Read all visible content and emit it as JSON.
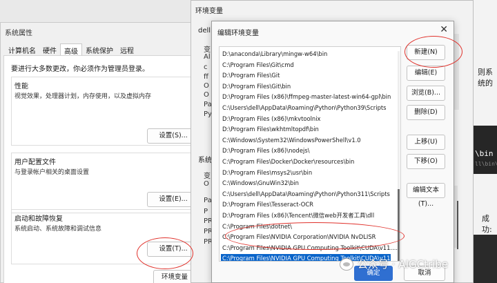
{
  "background": {
    "right_text_1": "则系统的",
    "terminal_line_1": "\\bin",
    "terminal_line_2": "ll\\bin\\v",
    "right_text_2": "成功:"
  },
  "system_properties": {
    "title": "系统属性",
    "tabs": [
      "计算机名",
      "硬件",
      "高级",
      "系统保护",
      "远程"
    ],
    "active_tab": "高级",
    "admin_note": "要进行大多数更改，你必须作为管理员登录。",
    "groups": [
      {
        "title": "性能",
        "desc": "视觉效果，处理器计划，内存使用，以及虚拟内存",
        "button": "设置(S)..."
      },
      {
        "title": "用户配置文件",
        "desc": "与登录帐户相关的桌面设置",
        "button": "设置(E)..."
      },
      {
        "title": "启动和故障恢复",
        "desc": "系统启动、系统故障和调试信息",
        "button": "设置(T)..."
      }
    ],
    "env_button": "环境变量(N)..."
  },
  "env_window": {
    "title": "环境变量",
    "user_section": "dell",
    "user_col": "变",
    "user_rows": [
      "Al",
      "c",
      "ff",
      "O",
      "O",
      "Pa",
      "Py"
    ],
    "sys_section": "系统",
    "sys_col": "变",
    "sys_rows": [
      "O",
      "Pa",
      "P",
      "PR",
      "PR",
      "PR"
    ]
  },
  "edit_dialog": {
    "title": "编辑环境变量",
    "close": "✕",
    "paths": [
      "D:\\anaconda\\Library\\mingw-w64\\bin",
      "C:\\Program Files\\Git\\cmd",
      "D:\\Program Files\\Git",
      "D:\\Program Files\\Git\\bin",
      "D:\\Program Files (x86)\\ffmpeg-master-latest-win64-gpl\\bin",
      "C:\\Users\\dell\\AppData\\Roaming\\Python\\Python39\\Scripts",
      "D:\\Program Files (x86)\\mkvtoolnix",
      "D:\\Program Files\\wkhtmltopdf\\bin",
      "C:\\Windows\\System32\\WindowsPowerShell\\v1.0",
      "D:\\Program Files (x86)\\nodejs\\",
      "C:\\Program Files\\Docker\\Docker\\resources\\bin",
      "D:\\Program Files\\msys2\\usr\\bin",
      "C:\\Windows\\GnuWin32\\bin",
      "C:\\Users\\dell\\AppData\\Roaming\\Python\\Python311\\Scripts",
      "D:\\Program Files\\Tesseract-OCR",
      "D:\\Program Files (x86)\\Tencent\\微信web开发者工具\\dll",
      "C:\\Program Files\\dotnet\\",
      "C:\\Program Files\\NVIDIA Corporation\\NVIDIA NvDLISR",
      "C:\\Program Files\\NVIDIA GPU Computing Toolkit\\CUDA\\v11....",
      "C:\\Program Files\\NVIDIA GPU Computing Toolkit\\CUDA\\v11...."
    ],
    "selected_index": 19,
    "buttons": {
      "new": "新建(N)",
      "edit": "编辑(E)",
      "browse": "浏览(B)...",
      "delete": "删除(D)",
      "move_up": "上移(U)",
      "move_down": "下移(O)",
      "edit_text": "编辑文本(T)..."
    },
    "ok": "确定",
    "cancel": "取消"
  },
  "watermark": "公众号 · AIGCtribe",
  "colors": {
    "annotation": "#e0302a",
    "selection": "#0a64c9",
    "primary_button": "#2f6fd1"
  }
}
